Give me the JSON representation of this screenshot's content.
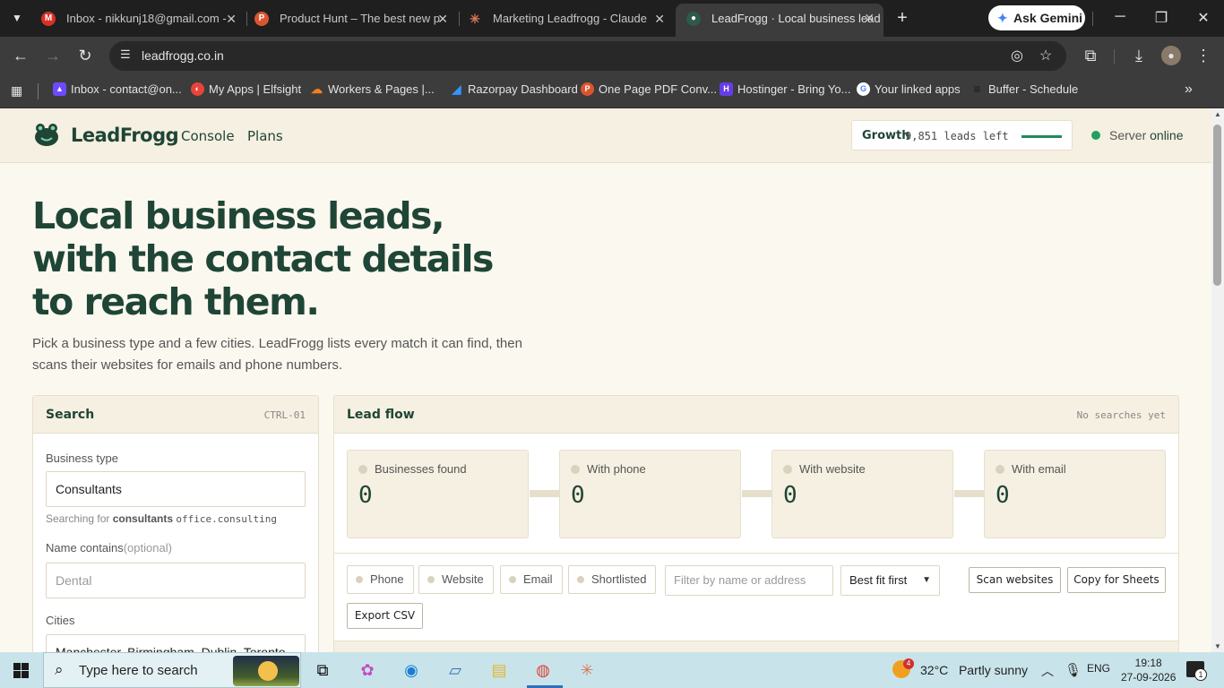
{
  "browser": {
    "tabs": [
      {
        "title": "Inbox - nikkunj18@gmail.com -",
        "icon": "gmail-icon",
        "color": "#d93025",
        "glyph": "M"
      },
      {
        "title": "Product Hunt – The best new p",
        "icon": "product-hunt-icon",
        "color": "#da552f",
        "glyph": "P"
      },
      {
        "title": "Marketing Leadfrogg - Claude",
        "icon": "claude-icon",
        "color": "#d97757",
        "glyph": "✳"
      },
      {
        "title": "LeadFrogg · Local business lead",
        "icon": "leadfrogg-icon",
        "color": "#1f4536",
        "glyph": "●"
      }
    ],
    "ask_gemini": "Ask Gemini",
    "url": "leadfrogg.co.in",
    "bookmarks": [
      {
        "label": "Inbox - contact@on...",
        "icon": "proton-mail-icon",
        "color": "#6d4aff",
        "glyph": "▲"
      },
      {
        "label": "My Apps | Elfsight",
        "icon": "elfsight-icon",
        "color": "#e8443a",
        "glyph": "◐"
      },
      {
        "label": "Workers & Pages |...",
        "icon": "cloudflare-icon",
        "color": "#f38020",
        "glyph": "☁"
      },
      {
        "label": "Razorpay Dashboard",
        "icon": "razorpay-icon",
        "color": "#3395ff",
        "glyph": "◢"
      },
      {
        "label": "One Page PDF Conv...",
        "icon": "pdf-converter-icon",
        "color": "#da552f",
        "glyph": "P"
      },
      {
        "label": "Hostinger - Bring Yo...",
        "icon": "hostinger-icon",
        "color": "#673de6",
        "glyph": "H"
      },
      {
        "label": "Your linked apps",
        "icon": "google-icon",
        "color": "#4285f4",
        "glyph": "G"
      },
      {
        "label": "Buffer - Schedule",
        "icon": "buffer-icon",
        "color": "#2a2a2a",
        "glyph": "≡"
      }
    ]
  },
  "app": {
    "brand": "LeadFrogg",
    "nav": [
      "Console",
      "Plans"
    ],
    "plan": {
      "name": "Growth",
      "leads_left": "9,851 leads left",
      "fill_fraction": 0.99
    },
    "server_status_prefix": "Server",
    "server_status_value": "online",
    "hero_title": "Local business leads, with the contact details to reach them.",
    "hero_sub": "Pick a business type and a few cities. LeadFrogg lists every match it can find, then scans their websites for emails and phone numbers.",
    "search": {
      "title": "Search",
      "shortcut": "CTRL-01",
      "business_type_label": "Business type",
      "business_type_value": "Consultants",
      "hint_prefix": "Searching for",
      "hint_term": "consultants",
      "hint_code": "office.consulting",
      "name_label": "Name contains",
      "name_optional": "(optional)",
      "name_placeholder": "Dental",
      "cities_label": "Cities",
      "cities_value": "Manchester, Birmingham, Dublin, Toronto"
    },
    "lead_flow": {
      "title": "Lead flow",
      "status": "No searches yet",
      "stats": [
        {
          "label": "Businesses found",
          "value": "0"
        },
        {
          "label": "With phone",
          "value": "0"
        },
        {
          "label": "With website",
          "value": "0"
        },
        {
          "label": "With email",
          "value": "0"
        }
      ],
      "chips": [
        "Phone",
        "Website",
        "Email",
        "Shortlisted"
      ],
      "filter_placeholder": "Filter by name or address",
      "sort_value": "Best fit first",
      "buttons": {
        "scan": "Scan websites",
        "copy": "Copy for Sheets",
        "export": "Export CSV"
      }
    }
  },
  "taskbar": {
    "search_placeholder": "Type here to search",
    "weather_temp": "32°C",
    "weather_desc": "Partly sunny",
    "weather_badge": "4",
    "language": "ENG",
    "time": "19:18",
    "date": "27-09-2026",
    "notification_count": "1"
  }
}
